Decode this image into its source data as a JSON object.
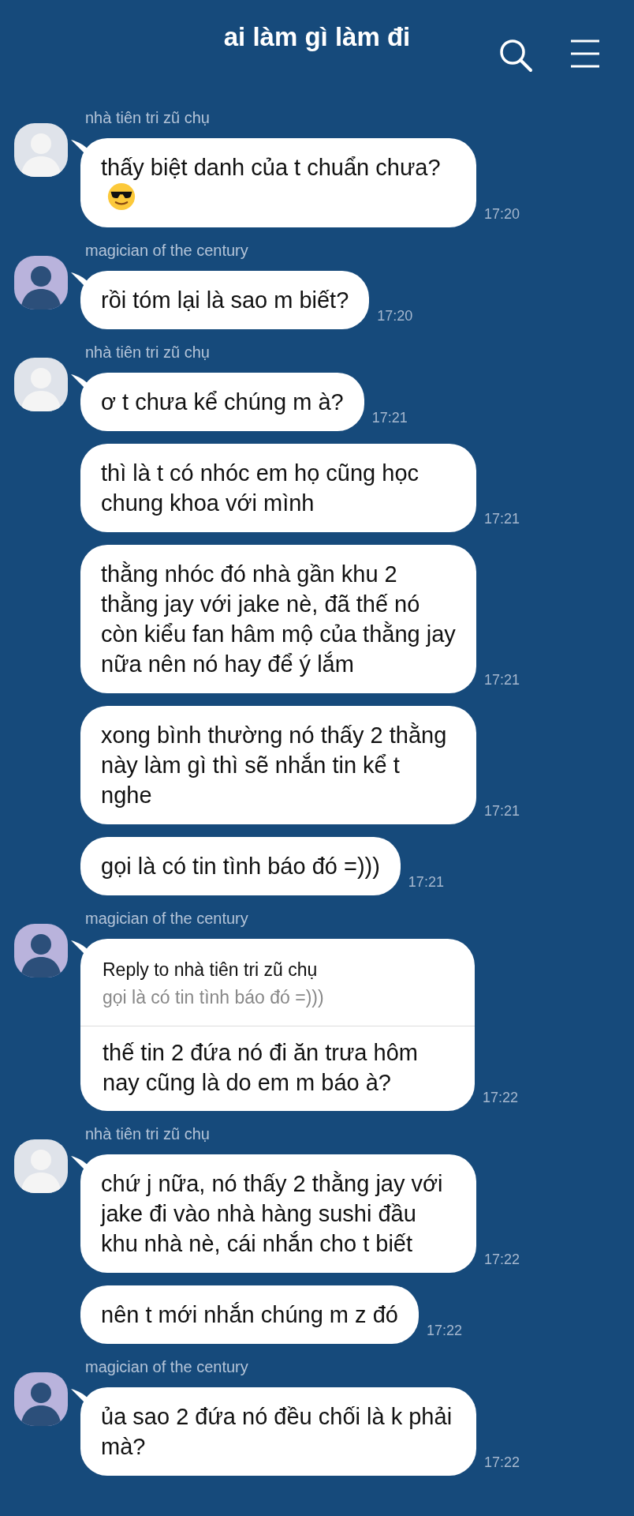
{
  "header": {
    "title": "ai làm gì làm đi"
  },
  "groups": [
    {
      "sender": "nhà tiên tri zũ chụ",
      "color": "#dfe3ea",
      "messages": [
        {
          "kind": "emoji",
          "text": "thấy biệt danh của t chuẩn chưa?",
          "time": "17:20"
        }
      ]
    },
    {
      "sender": "magician of the century",
      "color": "#b9b3dc",
      "messages": [
        {
          "kind": "text",
          "text": "rồi tóm lại là sao m biết?",
          "time": "17:20"
        }
      ]
    },
    {
      "sender": "nhà tiên tri zũ chụ",
      "color": "#dfe3ea",
      "messages": [
        {
          "kind": "text",
          "text": "ơ t chưa kể chúng m à?",
          "time": "17:21"
        },
        {
          "kind": "text",
          "text": "thì là t có nhóc em họ cũng học chung khoa với mình",
          "time": "17:21"
        },
        {
          "kind": "text",
          "text": "thằng nhóc đó nhà gần khu 2 thằng jay với jake nè, đã thế nó còn kiểu fan hâm mộ của thằng jay nữa nên nó hay để ý lắm",
          "time": "17:21"
        },
        {
          "kind": "text",
          "text": "xong bình thường nó thấy 2 thằng này làm gì thì sẽ nhắn tin kể t nghe",
          "time": "17:21"
        },
        {
          "kind": "text",
          "text": "gọi là có tin tình báo đó =)))",
          "time": "17:21"
        }
      ]
    },
    {
      "sender": "magician of the century",
      "color": "#b9b3dc",
      "messages": [
        {
          "kind": "reply",
          "reply": {
            "title": "Reply to nhà tiên tri zũ chụ",
            "quote": "gọi là có tin tình báo đó =)))"
          },
          "text": "thế tin 2 đứa nó đi ăn trưa hôm nay cũng là do em m báo à?",
          "time": "17:22"
        }
      ]
    },
    {
      "sender": "nhà tiên tri zũ chụ",
      "color": "#dfe3ea",
      "messages": [
        {
          "kind": "text",
          "text": "chứ j nữa, nó thấy 2 thằng jay với jake đi vào nhà hàng sushi đầu khu nhà nè, cái nhắn cho t biết",
          "time": "17:22"
        },
        {
          "kind": "text",
          "text": "nên t mới nhắn chúng m z đó",
          "time": "17:22"
        }
      ]
    },
    {
      "sender": "magician of the century",
      "color": "#b9b3dc",
      "messages": [
        {
          "kind": "text",
          "text": "ủa sao 2 đứa nó đều chối là k phải mà?",
          "time": "17:22"
        }
      ]
    }
  ]
}
